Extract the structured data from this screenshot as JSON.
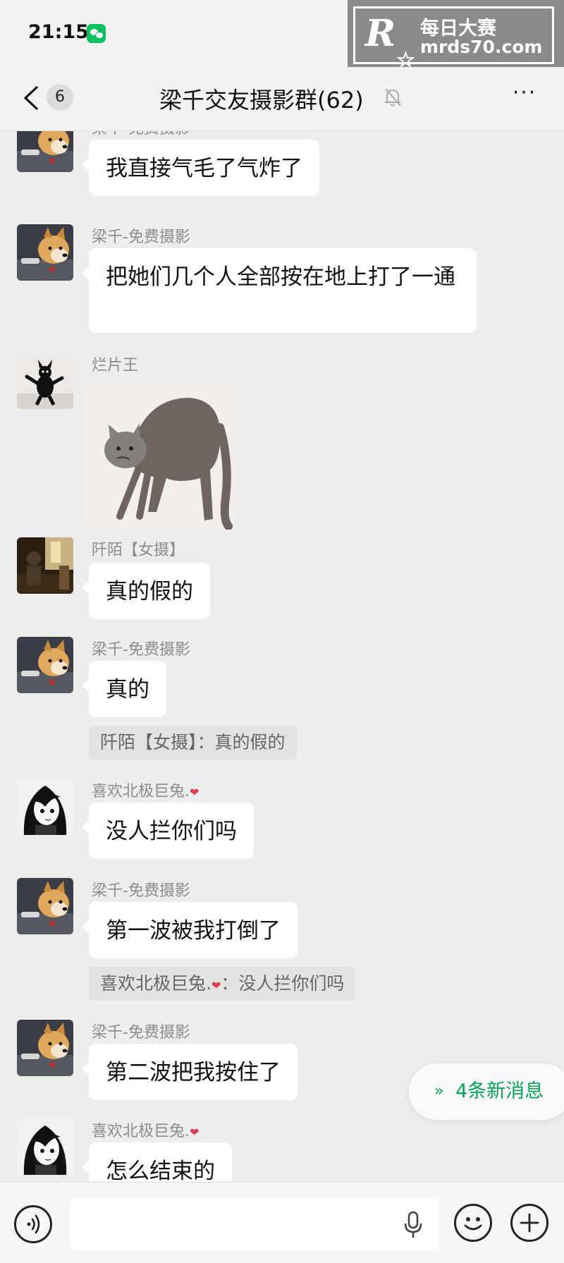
{
  "status_bar": {
    "time": "21:15",
    "notification_icon": "wechat-icon"
  },
  "watermark": {
    "logo_letter": "R",
    "logo_small": "每日大赛",
    "title": "每日大赛",
    "url": "mrds70.com"
  },
  "nav": {
    "back_icon": "chevron-left-icon",
    "unread_badge": "6",
    "title": "梁千交友摄影群(62)",
    "mute_icon": "bell-off-icon",
    "more_label": "···"
  },
  "messages": [
    {
      "type": "text",
      "sender": "梁千-免费摄影",
      "avatar": "dog-avatar",
      "text": "我直接气毛了气炸了"
    },
    {
      "type": "text",
      "sender": "梁千-免费摄影",
      "avatar": "dog-avatar",
      "text": "把她们几个人全部按在地上打了一通"
    },
    {
      "type": "sticker",
      "sender": "烂片王",
      "avatar": "black-cat-avatar",
      "sticker": "angry-cat-sticker"
    },
    {
      "type": "text",
      "sender": "阡陌【女摄】",
      "avatar": "dark-photo-avatar",
      "text": "真的假的"
    },
    {
      "type": "text",
      "sender": "梁千-免费摄影",
      "avatar": "dog-avatar",
      "text": "真的",
      "quote": "阡陌【女摄】：真的假的"
    },
    {
      "type": "text",
      "sender": "喜欢北极巨兔.",
      "sender_emoji": "heart-emoji",
      "avatar": "anime-girl-avatar",
      "text": "没人拦你们吗"
    },
    {
      "type": "text",
      "sender": "梁千-免费摄影",
      "avatar": "dog-avatar",
      "text": "第一波被我打倒了",
      "quote_sender": "喜欢北极巨兔.",
      "quote_text": "：没人拦你们吗"
    },
    {
      "type": "text",
      "sender": "梁千-免费摄影",
      "avatar": "dog-avatar",
      "text": "第二波把我按住了"
    },
    {
      "type": "text",
      "sender": "喜欢北极巨兔.",
      "sender_emoji": "heart-emoji",
      "avatar": "anime-girl-avatar",
      "text": "怎么结束的"
    }
  ],
  "new_messages_pill": {
    "icon": "double-chevron-down-icon",
    "label": "4条新消息"
  },
  "input_bar": {
    "voice_icon": "voice-icon",
    "mic_icon": "microphone-icon",
    "emoji_icon": "smiley-icon",
    "plus_icon": "plus-icon"
  },
  "colors": {
    "background": "#ededed",
    "bubble": "#ffffff",
    "accent_green": "#07c160",
    "new_msg_text": "#07a456"
  }
}
